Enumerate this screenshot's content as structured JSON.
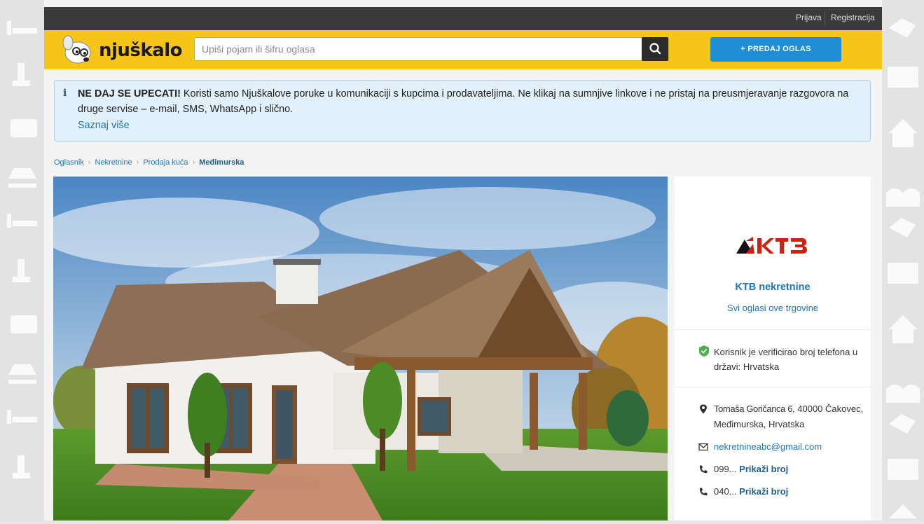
{
  "topbar": {
    "login": "Prijava",
    "register": "Registracija"
  },
  "header": {
    "logo_text": "njuškalo",
    "search_placeholder": "Upiši pojam ili šifru oglasa",
    "post_button": "+ PREDAJ OGLAS",
    "brand_color": "#f5c518",
    "accent_color": "#1e8fd6"
  },
  "notice": {
    "icon": "info-icon",
    "bold": "NE DAJ SE UPECATI!",
    "text": " Koristi samo Njuškalove poruke u komunikaciji s kupcima i prodavateljima. Ne klikaj na sumnjive linkove i ne pristaj na preusmjeravanje razgovora na druge servise – e-mail, SMS, WhatsApp i slično.",
    "more": "Saznaj više"
  },
  "breadcrumb": [
    "Oglasnik",
    "Nekretnine",
    "Prodaja kuća",
    "Međimurska"
  ],
  "seller": {
    "logo_text": "KTB",
    "name": "KTB nekretnine",
    "all_ads": "Svi oglasi ove trgovine",
    "verified": "Korisnik je verificirao broj telefona u državi: Hrvatska",
    "address_street": "Tomaša Goričanca 6",
    "address_rest": ", 40000 Čakovec, Međimurska, Hrvatska",
    "email": "nekretnineabc@gmail.com",
    "phones": [
      {
        "prefix": "099...",
        "action": "Prikaži broj"
      },
      {
        "prefix": "040...",
        "action": "Prikaži broj"
      }
    ]
  }
}
